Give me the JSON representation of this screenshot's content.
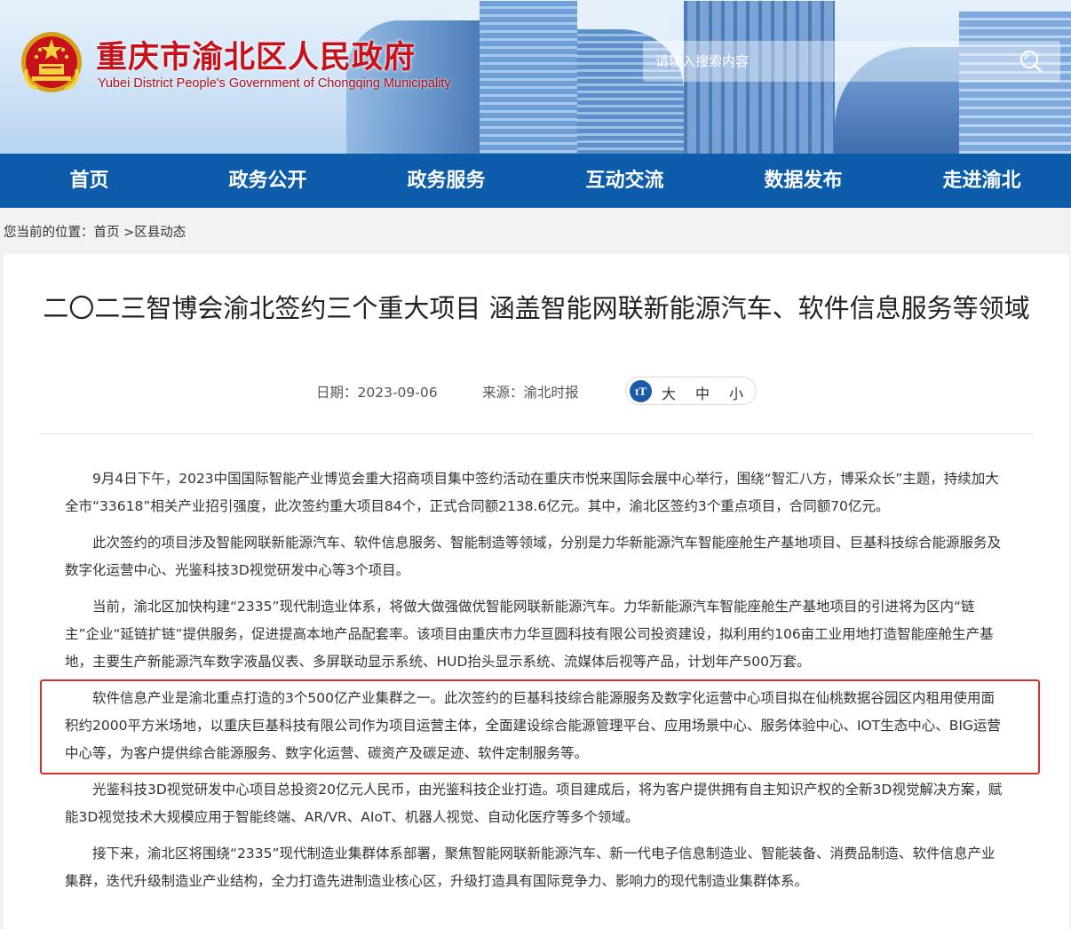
{
  "header": {
    "site_title": "重庆市渝北区人民政府",
    "site_subtitle": "Yubei District People's Government of Chongqing Municipality",
    "search_placeholder": "请输入搜索内容"
  },
  "nav": {
    "items": [
      {
        "label": "首页"
      },
      {
        "label": "政务公开"
      },
      {
        "label": "政务服务"
      },
      {
        "label": "互动交流"
      },
      {
        "label": "数据发布"
      },
      {
        "label": "走进渝北"
      }
    ]
  },
  "breadcrumb": {
    "prefix": "您当前的位置：",
    "home": "首页",
    "separator": " >",
    "current": "区县动态"
  },
  "article": {
    "title": "二〇二三智博会渝北签约三个重大项目 涵盖智能网联新能源汽车、软件信息服务等领域",
    "date": "日期：2023-09-06",
    "source": "来源：渝北时报",
    "font_switch": {
      "icon": "tT",
      "big": "大",
      "mid": "中",
      "small": "小"
    },
    "paragraphs": [
      "9月4日下午，2023中国国际智能产业博览会重大招商项目集中签约活动在重庆市悦来国际会展中心举行，围绕“智汇八方，博采众长”主题，持续加大全市“33618”相关产业招引强度，此次签约重大项目84个，正式合同额2138.6亿元。其中，渝北区签约3个重点项目，合同额70亿元。",
      "此次签约的项目涉及智能网联新能源汽车、软件信息服务、智能制造等领域，分别是力华新能源汽车智能座舱生产基地项目、巨基科技综合能源服务及数字化运营中心、光鉴科技3D视觉研发中心等3个项目。",
      "当前，渝北区加快构建“2335”现代制造业体系，将做大做强做优智能网联新能源汽车。力华新能源汽车智能座舱生产基地项目的引进将为区内“链主”企业“延链扩链”提供服务，促进提高本地产品配套率。该项目由重庆市力华亘圆科技有限公司投资建设，拟利用约106亩工业用地打造智能座舱生产基地，主要生产新能源汽车数字液晶仪表、多屏联动显示系统、HUD抬头显示系统、流媒体后视等产品，计划年产500万套。",
      "软件信息产业是渝北重点打造的3个500亿产业集群之一。此次签约的巨基科技综合能源服务及数字化运营中心项目拟在仙桃数据谷园区内租用使用面积约2000平方米场地，以重庆巨基科技有限公司作为项目运营主体，全面建设综合能源管理平台、应用场景中心、服务体验中心、IOT生态中心、BIG运营中心等，为客户提供综合能源服务、数字化运营、碳资产及碳足迹、软件定制服务等。",
      "光鉴科技3D视觉研发中心项目总投资20亿元人民币，由光鉴科技企业打造。项目建成后，将为客户提供拥有自主知识产权的全新3D视觉解决方案，赋能3D视觉技术大规模应用于智能终端、AR/VR、AIoT、机器人视觉、自动化医疗等多个领域。",
      "接下来，渝北区将围绕“2335”现代制造业集群体系部署，聚焦智能网联新能源汽车、新一代电子信息制造业、智能装备、消费品制造、软件信息产业集群，迭代升级制造业产业结构，全力打造先进制造业核心区，升级打造具有国际竞争力、影响力的现代制造业集群体系。"
    ]
  },
  "colors": {
    "nav_bg": "#0d5cac",
    "title_red": "#c8121b",
    "highlight_border": "#d93030"
  },
  "icons": {
    "emblem": "national-emblem-icon",
    "search": "search-icon",
    "font_size": "font-size-icon"
  }
}
